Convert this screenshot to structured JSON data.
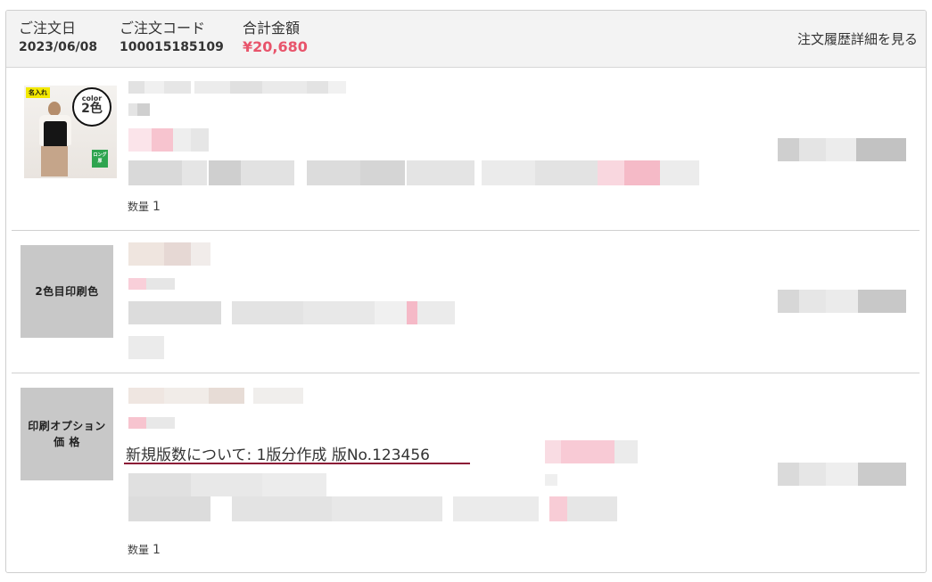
{
  "header": {
    "order_date_label": "ご注文日",
    "order_date": "2023/06/08",
    "order_code_label": "ご注文コード",
    "order_code": "100015185109",
    "total_label": "合計金額",
    "total": "¥20,680",
    "history_link": "注文履歴詳細を見る"
  },
  "items": [
    {
      "thumbnail": {
        "type": "product-photo",
        "tag": "名入れ",
        "circle_top": "color",
        "circle_bottom": "2色",
        "badge": "ロング厚"
      },
      "qty_label": "数量",
      "qty": "1"
    },
    {
      "thumbnail": {
        "type": "gray-label",
        "label": "2色目印刷色"
      }
    },
    {
      "thumbnail": {
        "type": "gray-label",
        "label_line1": "印刷オプション",
        "label_line2": "価 格"
      },
      "note": "新規版数について: 1版分作成 版No.123456",
      "qty_label": "数量",
      "qty": "1"
    }
  ],
  "colors": {
    "accent_total": "#e8546b",
    "note_underline": "#8b1535",
    "header_bg": "#f3f3f3",
    "thumb_gray": "#c8c8c8"
  }
}
